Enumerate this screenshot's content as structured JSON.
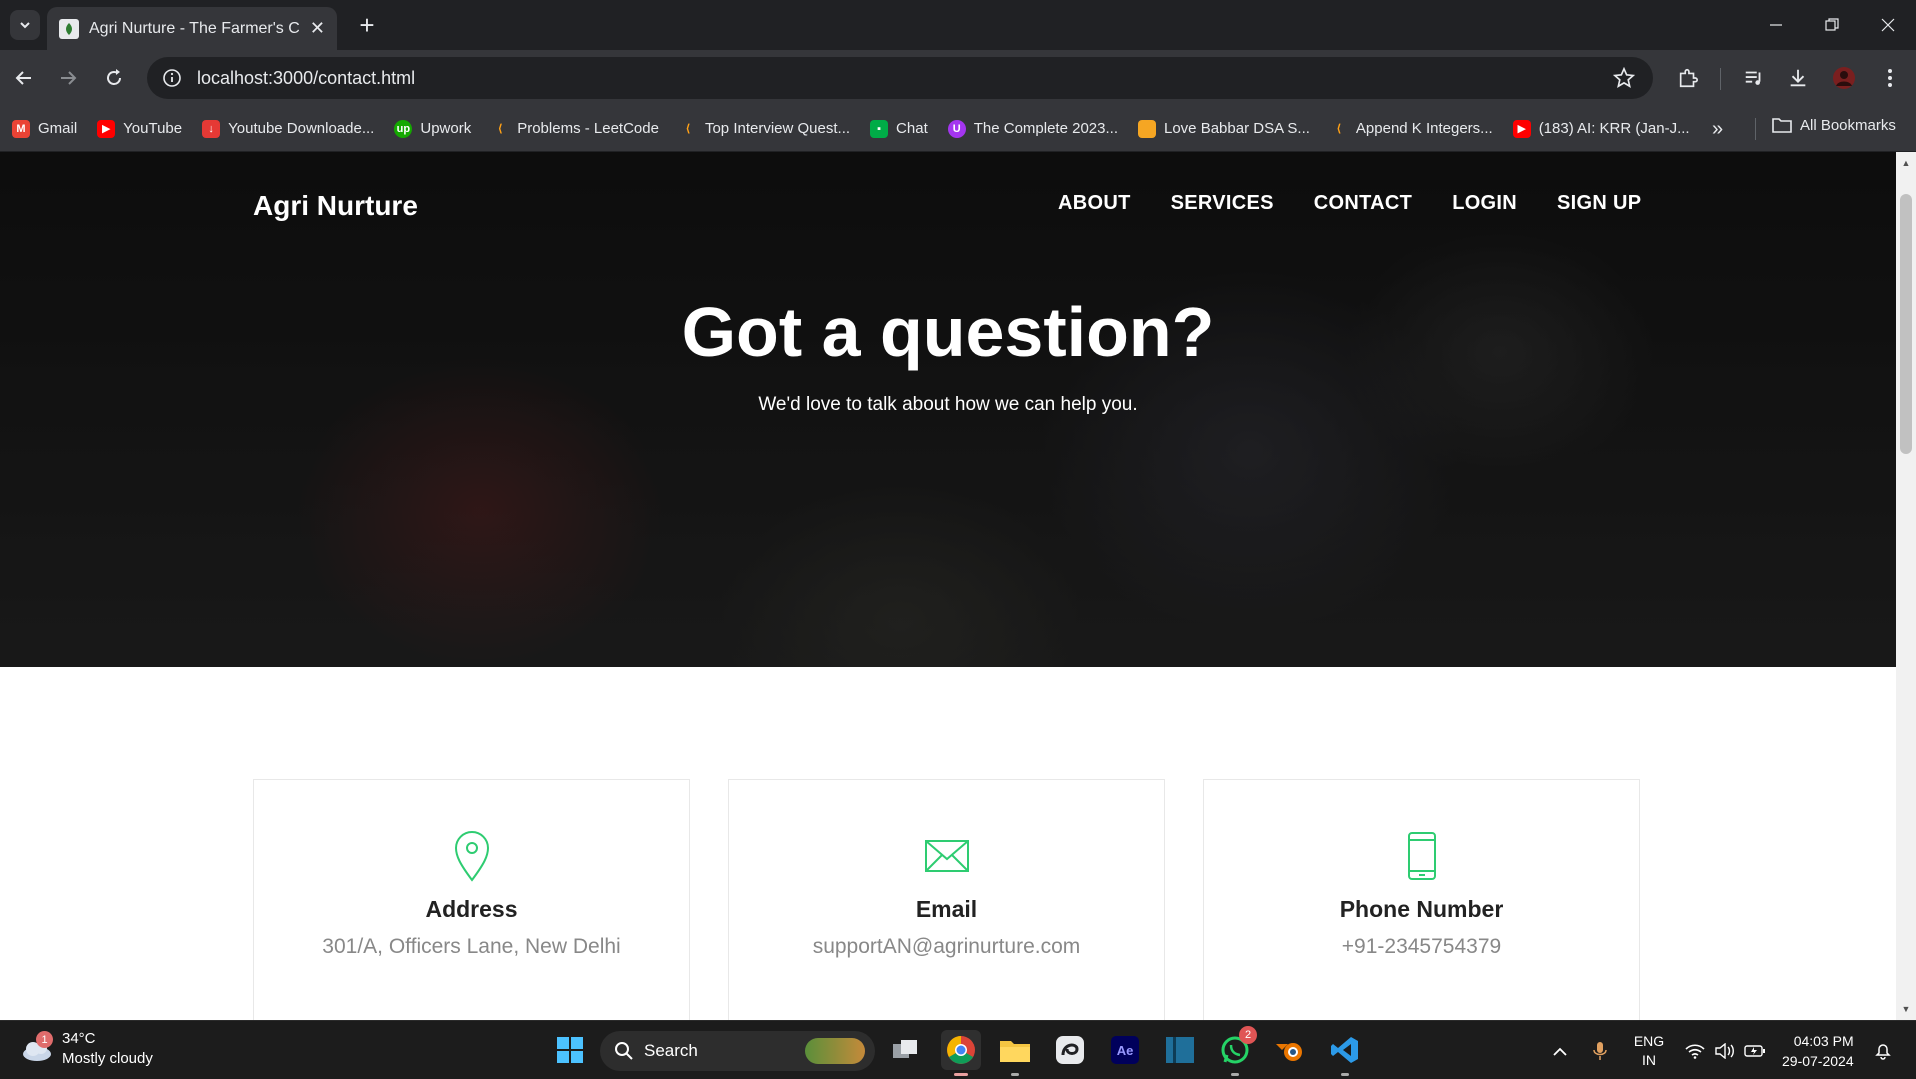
{
  "browser": {
    "tab_title": "Agri Nurture - The Farmer's Choice",
    "url": "localhost:3000/contact.html",
    "bookmarks": [
      {
        "label": "Gmail",
        "color": "#ea4335"
      },
      {
        "label": "YouTube",
        "color": "#ff0000"
      },
      {
        "label": "Youtube Downloade...",
        "color": "#e53935"
      },
      {
        "label": "Upwork",
        "color": "#14a800"
      },
      {
        "label": "Problems - LeetCode",
        "color": "#ffa116"
      },
      {
        "label": "Top Interview Quest...",
        "color": "#ffa116"
      },
      {
        "label": "Chat",
        "color": "#00ac47"
      },
      {
        "label": "The Complete 2023...",
        "color": "#a435f0"
      },
      {
        "label": "Love Babbar DSA S...",
        "color": "#f5a623"
      },
      {
        "label": "Append K Integers...",
        "color": "#ffa116"
      },
      {
        "label": "(183) AI: KRR (Jan-J...",
        "color": "#ff0000"
      }
    ],
    "all_bookmarks": "All Bookmarks"
  },
  "site": {
    "brand": "Agri Nurture",
    "nav": [
      "ABOUT",
      "SERVICES",
      "CONTACT",
      "LOGIN",
      "SIGN UP"
    ],
    "hero_title": "Got a question?",
    "hero_subtitle": "We'd love to talk about how we can help you.",
    "accent_color": "#2ecc71",
    "cards": [
      {
        "icon": "map-pin-icon",
        "title": "Address",
        "value": "301/A, Officers Lane, New Delhi"
      },
      {
        "icon": "envelope-icon",
        "title": "Email",
        "value": "supportAN@agrinurture.com"
      },
      {
        "icon": "mobile-phone-icon",
        "title": "Phone Number",
        "value": "+91-2345754379"
      }
    ]
  },
  "taskbar": {
    "weather_temp": "34°C",
    "weather_desc": "Mostly cloudy",
    "weather_badge": "1",
    "search_label": "Search",
    "whatsapp_badge": "2",
    "lang_line1": "ENG",
    "lang_line2": "IN",
    "time": "04:03 PM",
    "date": "29-07-2024"
  }
}
